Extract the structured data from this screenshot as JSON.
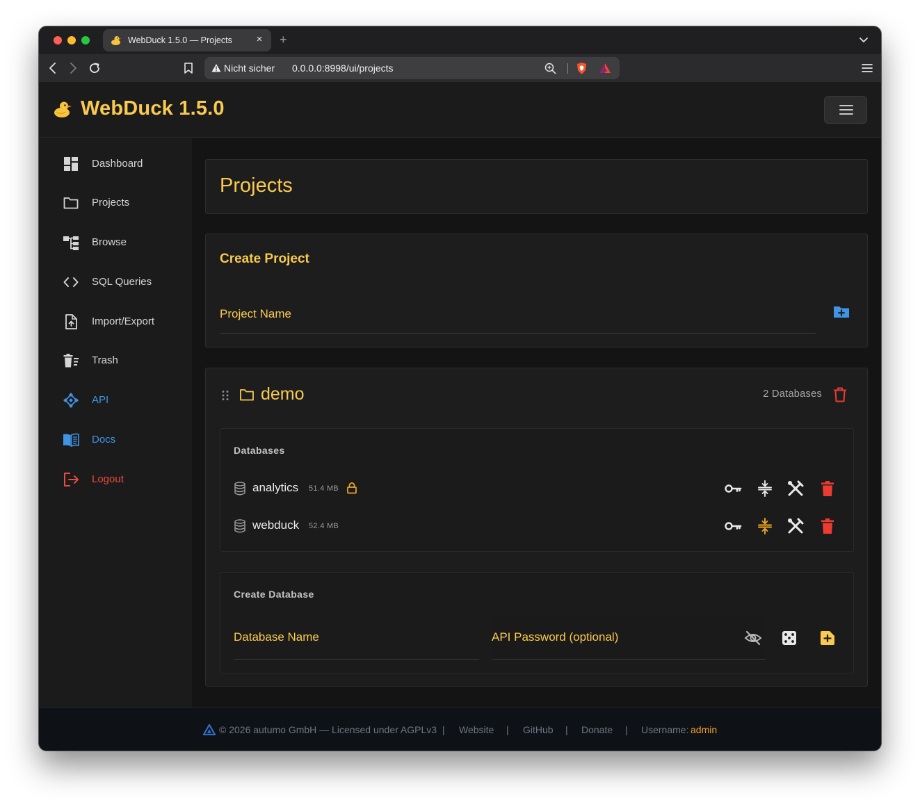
{
  "browser": {
    "tab_title": "WebDuck 1.5.0 — Projects",
    "tab_close": "×",
    "new_tab": "+",
    "insecure_label": "Nicht sicher",
    "url": "0.0.0.0:8998/ui/projects"
  },
  "app": {
    "title": "WebDuck 1.5.0",
    "accent_color": "#f9ca4f"
  },
  "sidebar": {
    "items": [
      {
        "label": "Dashboard",
        "icon": "dashboard-icon"
      },
      {
        "label": "Projects",
        "icon": "folder-icon"
      },
      {
        "label": "Browse",
        "icon": "tree-icon"
      },
      {
        "label": "SQL Queries",
        "icon": "code-icon"
      },
      {
        "label": "Import/Export",
        "icon": "file-upload-icon"
      },
      {
        "label": "Trash",
        "icon": "trash-icon"
      },
      {
        "label": "API",
        "icon": "api-icon"
      },
      {
        "label": "Docs",
        "icon": "book-icon"
      },
      {
        "label": "Logout",
        "icon": "logout-icon"
      }
    ]
  },
  "page": {
    "title": "Projects"
  },
  "create_project": {
    "title": "Create Project",
    "name_placeholder": "Project Name"
  },
  "project": {
    "name": "demo",
    "database_count": "2 Databases",
    "databases_title": "Databases",
    "databases": [
      {
        "name": "analytics",
        "size": "51.4 MB",
        "locked": true
      },
      {
        "name": "webduck",
        "size": "52.4 MB",
        "locked": false
      }
    ],
    "create_database": {
      "title": "Create Database",
      "name_placeholder": "Database Name",
      "password_placeholder": "API Password (optional)"
    }
  },
  "footer": {
    "copyright": "© 2026 autumo GmbH — Licensed under AGPLv3",
    "separator": "|",
    "website": "Website",
    "github": "GitHub",
    "donate": "Donate",
    "username_label": "Username:",
    "username": "admin"
  }
}
